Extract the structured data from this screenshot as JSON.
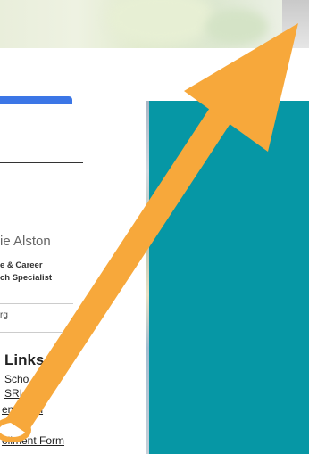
{
  "staff": {
    "name": "ie Alston",
    "title_line1": "e & Career",
    "title_line2": "ch Specialist",
    "small_text": "rg"
  },
  "links_section": {
    "heading": "Links",
    "items": [
      {
        "label": "Scho"
      },
      {
        "label": "SRI"
      },
      {
        "label": "endation"
      },
      {
        "label": "ollment Form"
      }
    ]
  },
  "colors": {
    "accent_blue": "#3b76e6",
    "teal_panel": "#0697a5",
    "arrow_orange": "#f7a83b"
  },
  "overlay": {
    "icon": "arrow-annotation-icon"
  }
}
